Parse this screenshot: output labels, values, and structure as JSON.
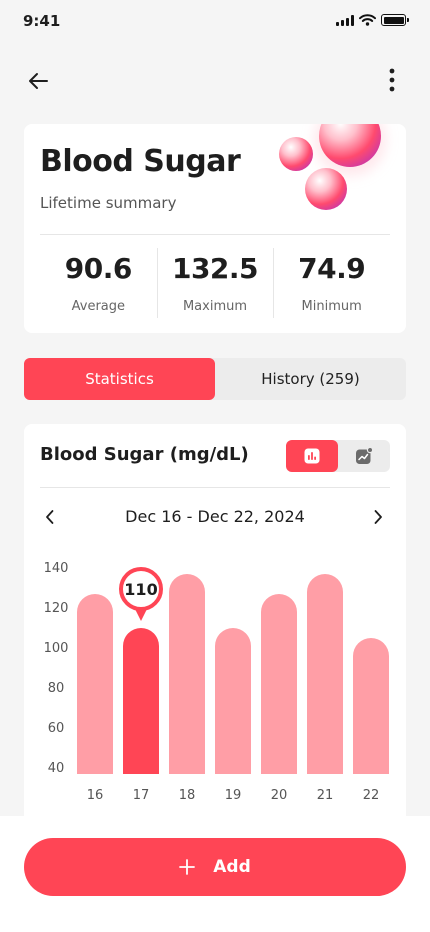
{
  "status_bar": {
    "time": "9:41"
  },
  "summary": {
    "title": "Blood Sugar",
    "subtitle": "Lifetime summary",
    "stats": [
      {
        "value": "90.6",
        "label": "Average"
      },
      {
        "value": "132.5",
        "label": "Maximum"
      },
      {
        "value": "74.9",
        "label": "Minimum"
      }
    ]
  },
  "tabs": [
    {
      "label": "Statistics",
      "active": true
    },
    {
      "label": "History (259)",
      "active": false
    }
  ],
  "chart_card": {
    "title": "Blood Sugar (mg/dL)",
    "date_range": "Dec 16 - Dec 22, 2024"
  },
  "chart_data": {
    "type": "bar",
    "categories": [
      "16",
      "17",
      "18",
      "19",
      "20",
      "21",
      "22"
    ],
    "values": [
      130,
      113,
      140,
      113,
      130,
      140,
      108
    ],
    "highlighted_index": 1,
    "highlight_label": "110",
    "yticks": [
      140,
      120,
      100,
      80,
      60,
      40
    ],
    "ylim": [
      40,
      140
    ],
    "grid": false,
    "colors": {
      "bar": "#ff9ea6",
      "highlight": "#ff4555"
    }
  },
  "bottom": {
    "add_label": "Add"
  },
  "colors": {
    "accent": "#ff4555",
    "bar_light": "#ff9ea6",
    "background": "#f5f5f5"
  }
}
